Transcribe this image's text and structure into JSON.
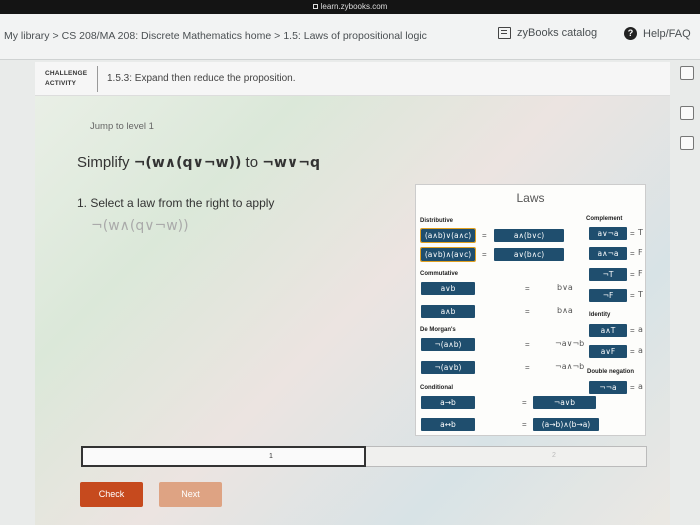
{
  "browser": {
    "url": "learn.zybooks.com"
  },
  "nav": {
    "breadcrumb": [
      "My library",
      "CS 208/MA 208: Discrete Mathematics home",
      "1.5: Laws of propositional logic"
    ],
    "catalog_label": "zyBooks catalog",
    "help_label": "Help/FAQ"
  },
  "challenge": {
    "tag_line1": "CHALLENGE",
    "tag_line2": "ACTIVITY",
    "title": "1.5.3: Expand then reduce the proposition."
  },
  "main": {
    "jump_label": "Jump to level 1",
    "simplify_prefix": "Simplify",
    "simplify_from": "¬(w∧(q∨¬w))",
    "simplify_to_word": "to",
    "simplify_to": "¬w∨¬q",
    "step_text": "1. Select a law from the right to apply",
    "current_expr": "¬(w∧(q∨¬w))"
  },
  "laws": {
    "title": "Laws",
    "distributive": {
      "heading": "Distributive",
      "rows": [
        {
          "left": "(a∧b)∨(a∧c)",
          "eq": "=",
          "right": "a∧(b∨c)"
        },
        {
          "left": "(a∨b)∧(a∨c)",
          "eq": "=",
          "right": "a∨(b∧c)"
        }
      ]
    },
    "commutative": {
      "heading": "Commutative",
      "rows": [
        {
          "left": "a∨b",
          "eq": "=",
          "right": "b∨a"
        },
        {
          "left": "a∧b",
          "eq": "=",
          "right": "b∧a"
        }
      ]
    },
    "de_morgans": {
      "heading": "De Morgan's",
      "rows": [
        {
          "left": "¬(a∧b)",
          "eq": "=",
          "right": "¬a∨¬b"
        },
        {
          "left": "¬(a∨b)",
          "eq": "=",
          "right": "¬a∧¬b"
        }
      ]
    },
    "conditional": {
      "heading": "Conditional",
      "rows": [
        {
          "left": "a→b",
          "eq": "=",
          "right": "¬a∨b"
        },
        {
          "left": "a↔b",
          "eq": "=",
          "right": "(a→b)∧(b→a)"
        }
      ]
    },
    "complement": {
      "heading": "Complement",
      "rows": [
        {
          "left": "a∨¬a",
          "eq": "=",
          "right": "T"
        },
        {
          "left": "a∧¬a",
          "eq": "=",
          "right": "F"
        },
        {
          "left": "¬T",
          "eq": "=",
          "right": "F"
        },
        {
          "left": "¬F",
          "eq": "=",
          "right": "T"
        }
      ]
    },
    "identity": {
      "heading": "Identity",
      "rows": [
        {
          "left": "a∧T",
          "eq": "=",
          "right": "a"
        },
        {
          "left": "a∨F",
          "eq": "=",
          "right": "a"
        }
      ]
    },
    "double_negation": {
      "heading": "Double negation",
      "rows": [
        {
          "left": "¬¬a",
          "eq": "=",
          "right": "a"
        }
      ]
    }
  },
  "progress": {
    "level1": "1",
    "level2": "2"
  },
  "buttons": {
    "check": "Check",
    "next": "Next"
  }
}
